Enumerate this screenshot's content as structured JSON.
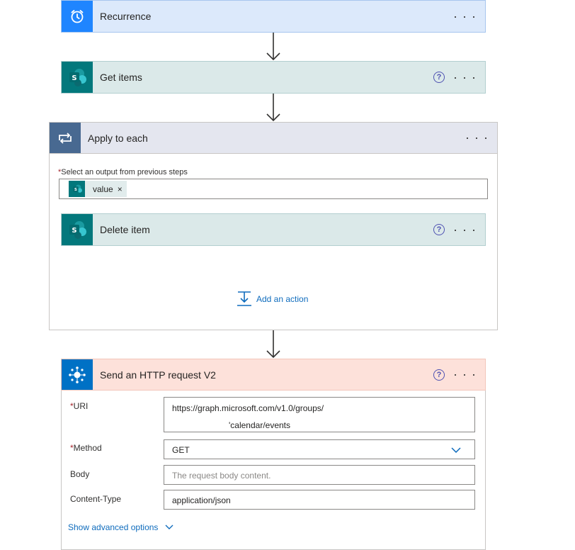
{
  "recurrence": {
    "title": "Recurrence",
    "more": "· · ·"
  },
  "get_items": {
    "title": "Get items",
    "help": "?",
    "more": "· · ·"
  },
  "apply_each": {
    "title": "Apply to each",
    "more": "· · ·",
    "select_label": "Select an output from previous steps",
    "required_mark": "*",
    "token": "value",
    "token_remove": "×",
    "delete_item": {
      "title": "Delete item",
      "help": "?",
      "more": "· · ·"
    },
    "add_action": "Add an action"
  },
  "http": {
    "title": "Send an HTTP request V2",
    "help": "?",
    "more": "· · ·",
    "uri_label": "URI",
    "uri_line1": "https://graph.microsoft.com/v1.0/groups/",
    "uri_line2": "'calendar/events",
    "method_label": "Method",
    "method_value": "GET",
    "body_label": "Body",
    "body_placeholder": "The request body content.",
    "content_type_label": "Content-Type",
    "content_type_value": "application/json",
    "advanced": "Show advanced options"
  },
  "colors": {
    "recurrence_bg": "#dce9fb",
    "recurrence_icon": "#1f85ff",
    "sharepoint_bg": "#dbe9e9",
    "sharepoint_icon": "#03787c",
    "loop_bg": "#e4e6ef",
    "loop_icon": "#486991",
    "http_bg": "#fde1da",
    "http_icon": "#0071c5",
    "link": "#0f6cbd"
  }
}
